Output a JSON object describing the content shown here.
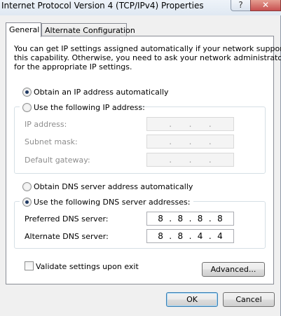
{
  "window": {
    "title": "Internet Protocol Version 4 (TCP/IPv4) Properties",
    "help_label": "?",
    "close_label": "✕"
  },
  "tabs": [
    {
      "label": "General",
      "active": true
    },
    {
      "label": "Alternate Configuration",
      "active": false
    }
  ],
  "description": [
    "You can get IP settings assigned automatically if your network supports",
    "this capability. Otherwise, you need to ask your network administrator",
    "for the appropriate IP settings."
  ],
  "ip_section": {
    "auto_label": "Obtain an IP address automatically",
    "manual_label": "Use the following IP address:",
    "selected": "auto",
    "fields": [
      {
        "label": "IP address:",
        "octets": [
          "",
          "",
          "",
          ""
        ]
      },
      {
        "label": "Subnet mask:",
        "octets": [
          "",
          "",
          "",
          ""
        ]
      },
      {
        "label": "Default gateway:",
        "octets": [
          "",
          "",
          "",
          ""
        ]
      }
    ]
  },
  "dns_section": {
    "auto_label": "Obtain DNS server address automatically",
    "manual_label": "Use the following DNS server addresses:",
    "selected": "manual",
    "preferred": {
      "label": "Preferred DNS server:",
      "octets": [
        "8",
        "8",
        "8",
        "8"
      ]
    },
    "alternate": {
      "label": "Alternate DNS server:",
      "octets": [
        "8",
        "8",
        "4",
        "4"
      ]
    }
  },
  "validate": {
    "label": "Validate settings upon exit",
    "checked": false
  },
  "buttons": {
    "advanced": "Advanced...",
    "ok": "OK",
    "cancel": "Cancel"
  }
}
